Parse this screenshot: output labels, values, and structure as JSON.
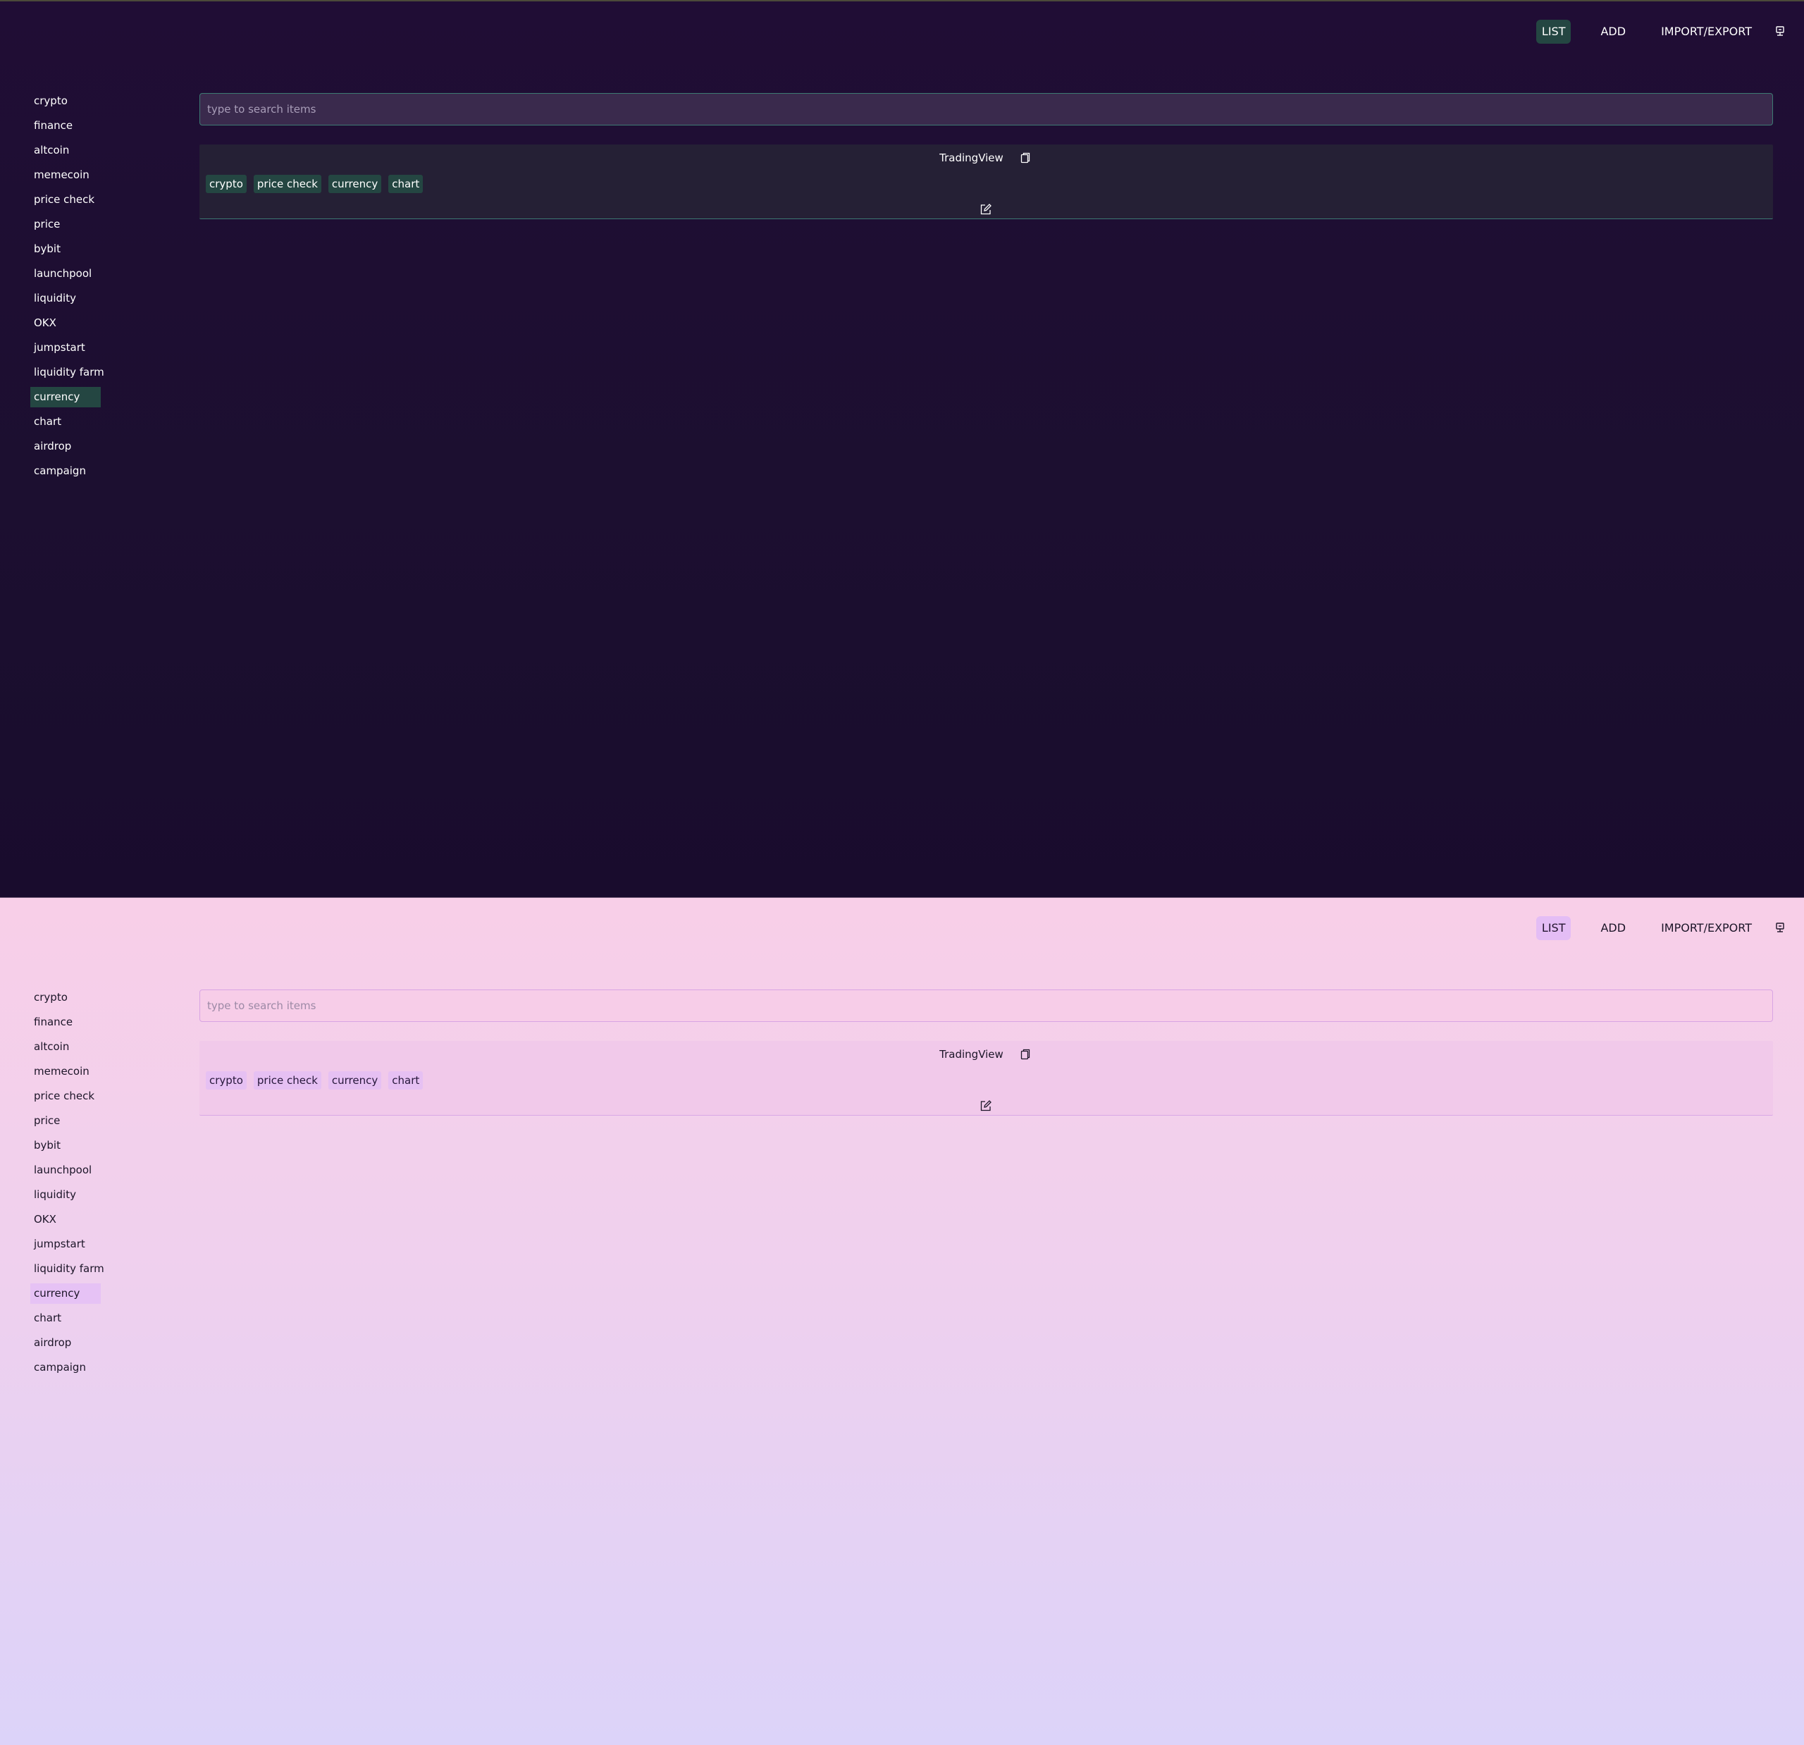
{
  "themes": {
    "dark": {
      "background": "#1c0f30",
      "accent": "#244642",
      "text": "#ffffff"
    },
    "light": {
      "background": "#f1cfed",
      "accent": "#e6c2f5",
      "text": "#1c1528"
    }
  },
  "nav": {
    "list": "LIST",
    "add": "ADD",
    "import_export": "IMPORT/EXPORT",
    "logout_icon": "logout-icon"
  },
  "sidebar": {
    "tags": [
      "crypto",
      "finance",
      "altcoin",
      "memecoin",
      "price check",
      "price",
      "bybit",
      "launchpool",
      "liquidity",
      "OKX",
      "jumpstart",
      "liquidity farm",
      "currency",
      "chart",
      "airdrop",
      "campaign"
    ],
    "selected": "currency"
  },
  "search": {
    "placeholder": "type to search items",
    "value": ""
  },
  "items": [
    {
      "title": "TradingView",
      "copy_icon": "copy-icon",
      "edit_icon": "edit-icon",
      "tags": [
        "crypto",
        "price check",
        "currency",
        "chart"
      ]
    }
  ]
}
